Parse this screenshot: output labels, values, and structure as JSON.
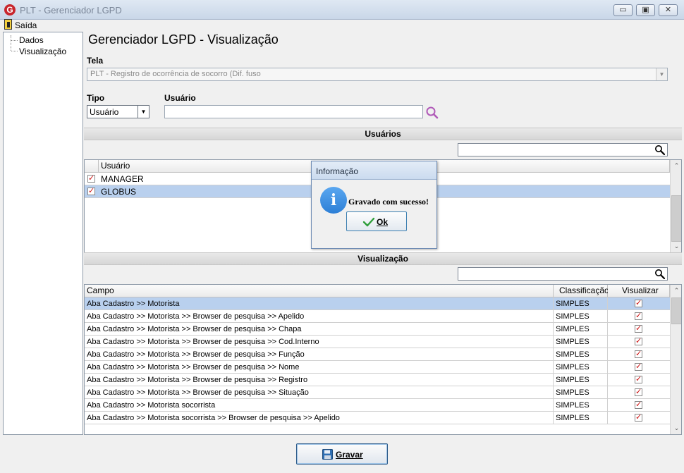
{
  "window": {
    "logo_letter": "G",
    "title": "PLT - Gerenciador LGPD",
    "minimize": "▭",
    "maximize": "▣",
    "close": "✕"
  },
  "menu": {
    "exit_label": "Saída"
  },
  "tree": {
    "items": [
      {
        "label": "Dados"
      },
      {
        "label": "Visualização"
      }
    ]
  },
  "main": {
    "title": "Gerenciador LGPD - Visualização",
    "screen_label": "Tela",
    "screen_value": "PLT - Registro de ocorrência de socorro (Dif. fuso",
    "type_label": "Tipo",
    "type_value": "Usuário",
    "user_label": "Usuário",
    "user_value": ""
  },
  "users_section": {
    "header": "Usuários",
    "filter_value": "",
    "column_user": "Usuário",
    "rows": [
      {
        "name": "MANAGER",
        "checked": true,
        "selected": false
      },
      {
        "name": "GLOBUS",
        "checked": true,
        "selected": true
      }
    ]
  },
  "view_section": {
    "header": "Visualização",
    "filter_value": "",
    "columns": {
      "field": "Campo",
      "classification": "Classificação",
      "view": "Visualizar"
    },
    "rows": [
      {
        "field": "Aba Cadastro >> Motorista",
        "classification": "SIMPLES",
        "visible": true,
        "selected": true
      },
      {
        "field": "Aba Cadastro >> Motorista >> Browser de pesquisa >> Apelido",
        "classification": "SIMPLES",
        "visible": true,
        "selected": false
      },
      {
        "field": "Aba Cadastro >> Motorista >> Browser de pesquisa >> Chapa",
        "classification": "SIMPLES",
        "visible": true,
        "selected": false
      },
      {
        "field": "Aba Cadastro >> Motorista >> Browser de pesquisa >> Cod.Interno",
        "classification": "SIMPLES",
        "visible": true,
        "selected": false
      },
      {
        "field": "Aba Cadastro >> Motorista >> Browser de pesquisa >> Função",
        "classification": "SIMPLES",
        "visible": true,
        "selected": false
      },
      {
        "field": "Aba Cadastro >> Motorista >> Browser de pesquisa >> Nome",
        "classification": "SIMPLES",
        "visible": true,
        "selected": false
      },
      {
        "field": "Aba Cadastro >> Motorista >> Browser de pesquisa >> Registro",
        "classification": "SIMPLES",
        "visible": true,
        "selected": false
      },
      {
        "field": "Aba Cadastro >> Motorista >> Browser de pesquisa >> Situação",
        "classification": "SIMPLES",
        "visible": true,
        "selected": false
      },
      {
        "field": "Aba Cadastro >> Motorista socorrista",
        "classification": "SIMPLES",
        "visible": true,
        "selected": false
      },
      {
        "field": "Aba Cadastro >> Motorista socorrista >> Browser de pesquisa >> Apelido",
        "classification": "SIMPLES",
        "visible": true,
        "selected": false
      }
    ]
  },
  "dialog": {
    "title": "Informação",
    "icon_letter": "i",
    "message": "Gravado com sucesso!",
    "ok_label": "Ok"
  },
  "footer": {
    "save_label": "Gravar"
  },
  "colors": {
    "selection": "#b9d0ee",
    "check": "#cc1010",
    "accent": "#2d7fd6"
  },
  "icons": [
    "app-logo-icon",
    "exit-icon",
    "search-icon",
    "info-icon",
    "check-icon",
    "floppy-disk-icon"
  ]
}
